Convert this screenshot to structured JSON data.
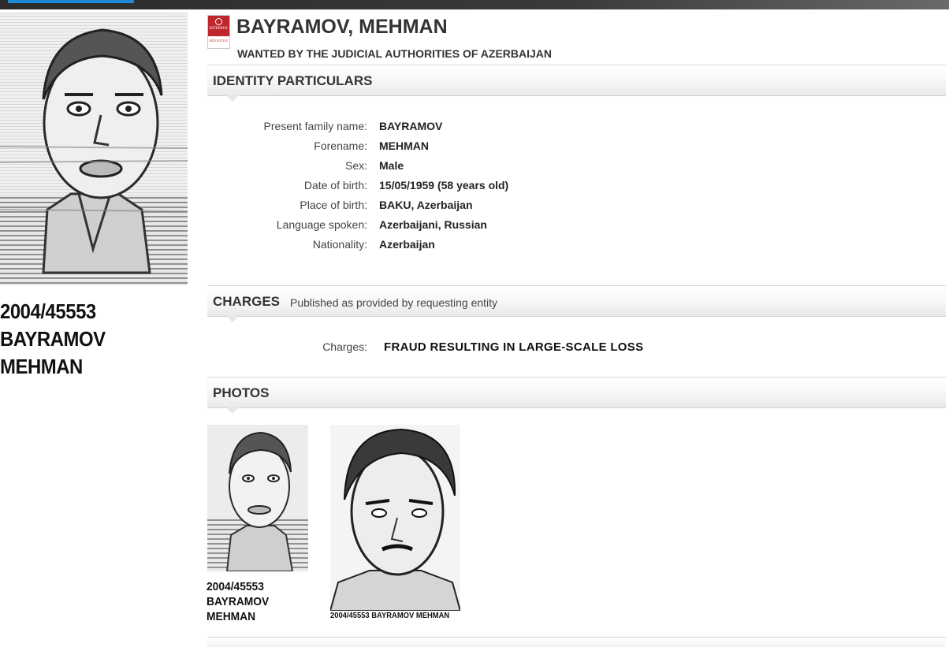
{
  "header": {
    "notice_badge_top": "INTERPOL",
    "notice_badge_bottom": "RED NOTICE",
    "title": "BAYRAMOV, MEHMAN",
    "subtitle": "WANTED BY THE JUDICIAL AUTHORITIES OF AZERBAIJAN"
  },
  "main_photo": {
    "caption_line1": "2004/45553",
    "caption_line2": "BAYRAMOV",
    "caption_line3": "MEHMAN"
  },
  "identity": {
    "section_title": "IDENTITY PARTICULARS",
    "rows": [
      {
        "label": "Present family name:",
        "value": "BAYRAMOV"
      },
      {
        "label": "Forename:",
        "value": "MEHMAN"
      },
      {
        "label": "Sex:",
        "value": "Male"
      },
      {
        "label": "Date of birth:",
        "value": "15/05/1959 (58 years old)"
      },
      {
        "label": "Place of birth:",
        "value": "BAKU, Azerbaijan"
      },
      {
        "label": "Language spoken:",
        "value": "Azerbaijani, Russian"
      },
      {
        "label": "Nationality:",
        "value": "Azerbaijan"
      }
    ]
  },
  "charges": {
    "section_title": "CHARGES",
    "note": "Published as provided by requesting entity",
    "label": "Charges:",
    "value": "FRAUD RESULTING IN LARGE-SCALE LOSS"
  },
  "photos": {
    "section_title": "PHOTOS",
    "thumb1_caption_line1": "2004/45553",
    "thumb1_caption_line2": "BAYRAMOV",
    "thumb1_caption_line3": "MEHMAN",
    "thumb2_caption": "2004/45553 BAYRAMOV MEHMAN"
  }
}
